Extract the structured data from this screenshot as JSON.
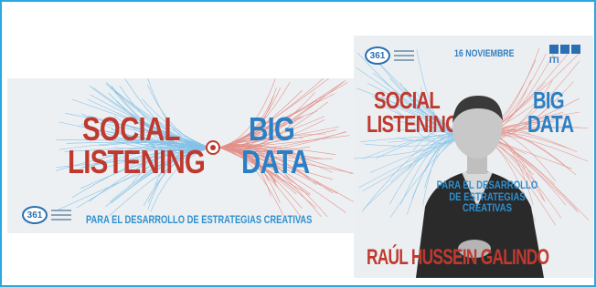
{
  "banner": {
    "word_social": "SOCIAL",
    "word_listening": "LISTENING",
    "word_big": "BIG",
    "word_data": "DATA",
    "subtitle": "PARA EL DESARROLLO DE ESTRATEGIAS CREATIVAS",
    "logo_text": "361"
  },
  "poster": {
    "logo_text": "361",
    "date": "16 NOVIEMBRE",
    "iti_text": "ITI",
    "word_social": "SOCIAL",
    "word_listening": "LISTENING",
    "word_big": "BIG",
    "word_data": "DATA",
    "subtitle_line1": "PARA EL DESARROLLO",
    "subtitle_line2": "DE ESTRATEGIAS CREATIVAS",
    "speaker_name": "RAÚL HUSSEIN GALINDO"
  },
  "colors": {
    "frame_border": "#29a9e0",
    "red": "#c0392f",
    "blue": "#2b7fc4",
    "background": "#edf0f2"
  }
}
